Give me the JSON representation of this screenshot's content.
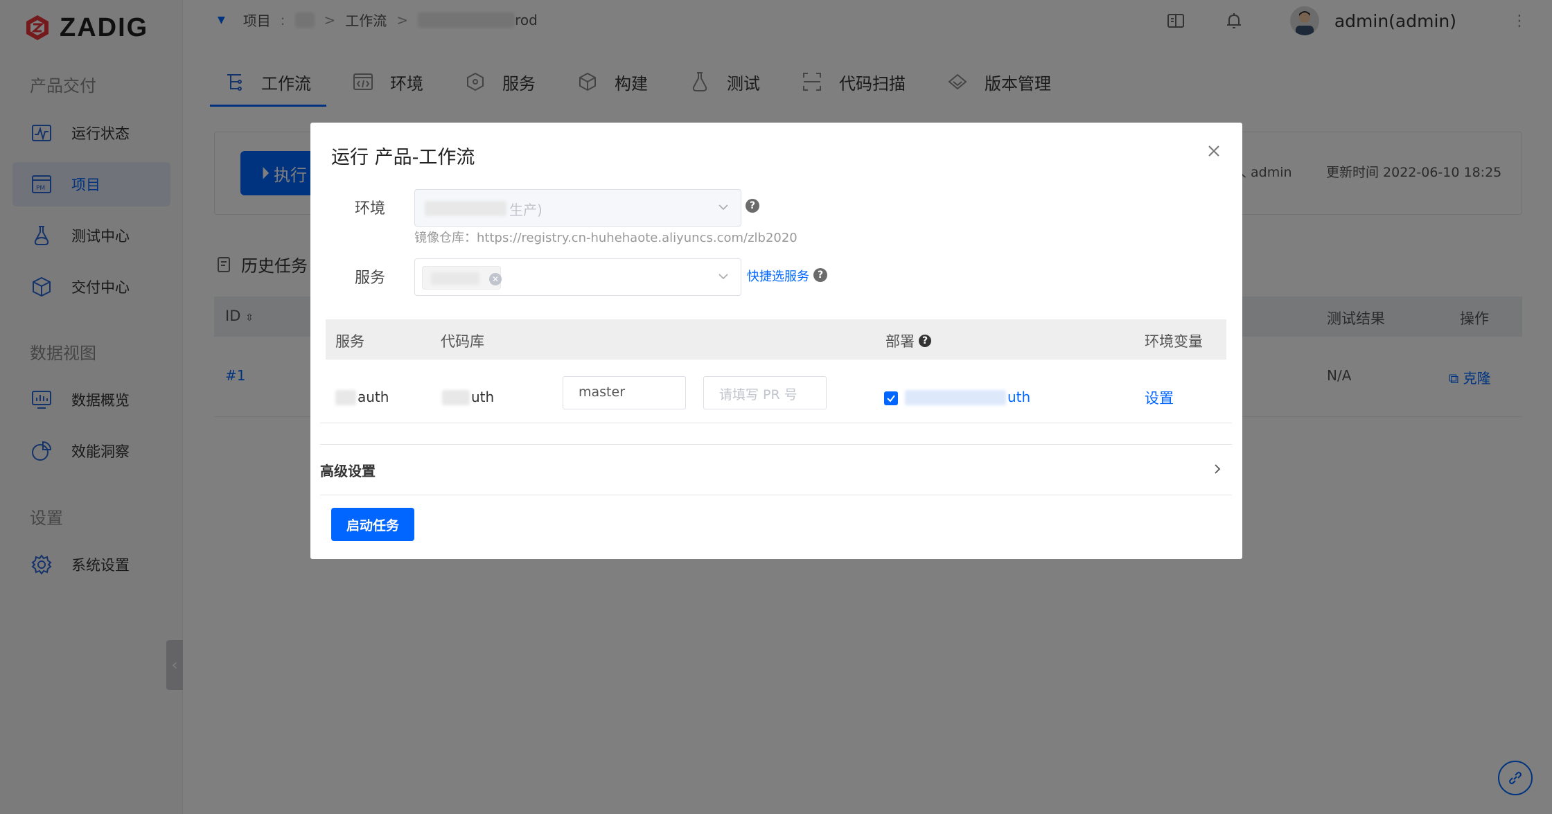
{
  "app": {
    "logo_text": "ZADIG"
  },
  "sidebar": {
    "sections": [
      {
        "title": "产品交付",
        "items": [
          {
            "label": "运行状态",
            "icon": "activity-icon",
            "active": false
          },
          {
            "label": "项目",
            "icon": "project-pm-icon",
            "active": true
          },
          {
            "label": "测试中心",
            "icon": "flask-icon",
            "active": false
          },
          {
            "label": "交付中心",
            "icon": "package-icon",
            "active": false
          }
        ]
      },
      {
        "title": "数据视图",
        "items": [
          {
            "label": "数据概览",
            "icon": "dashboard-icon",
            "active": false
          },
          {
            "label": "效能洞察",
            "icon": "pie-chart-icon",
            "active": false
          }
        ]
      },
      {
        "title": "设置",
        "items": [
          {
            "label": "系统设置",
            "icon": "gear-icon",
            "active": false
          }
        ]
      }
    ]
  },
  "topbar": {
    "breadcrumb": {
      "project": "项目",
      "workflow": "工作流",
      "current_suffix": "rod"
    },
    "username": "admin(admin)"
  },
  "tabs": [
    {
      "label": "工作流",
      "icon": "workflow-icon",
      "active": true
    },
    {
      "label": "环境",
      "icon": "code-window-icon",
      "active": false
    },
    {
      "label": "服务",
      "icon": "cube-network-icon",
      "active": false
    },
    {
      "label": "构建",
      "icon": "box-icon",
      "active": false
    },
    {
      "label": "测试",
      "icon": "flask-icon",
      "active": false
    },
    {
      "label": "代码扫描",
      "icon": "scan-icon",
      "active": false
    },
    {
      "label": "版本管理",
      "icon": "diamond-icon",
      "active": false
    }
  ],
  "workflow_card": {
    "execute_label": "执行",
    "modifier_label": "人 admin",
    "updated_label": "更新时间 2022-06-10 18:25"
  },
  "history": {
    "title": "历史任务",
    "columns": {
      "id": "ID",
      "test_result": "测试结果",
      "action": "操作"
    },
    "rows": [
      {
        "id": "#1",
        "test_result": "N/A",
        "action": "克隆"
      }
    ]
  },
  "modal": {
    "title": "运行 产品-工作流",
    "env_label": "环境",
    "env_value_suffix": "生产)",
    "registry_hint": "镜像仓库：https://registry.cn-huhehaote.aliyuncs.com/zlb2020",
    "service_label": "服务",
    "quick_select": "快捷选服务",
    "table": {
      "headers": {
        "service": "服务",
        "repo": "代码库",
        "deploy": "部署",
        "env_vars": "环境变量"
      },
      "rows": [
        {
          "service_suffix": "auth",
          "repo_suffix": "uth",
          "branch": "master",
          "pr_placeholder": "请填写 PR 号",
          "deploy_checked": true,
          "deploy_suffix": "uth",
          "env_action": "设置"
        }
      ]
    },
    "advanced_label": "高级设置",
    "start_button": "启动任务"
  }
}
